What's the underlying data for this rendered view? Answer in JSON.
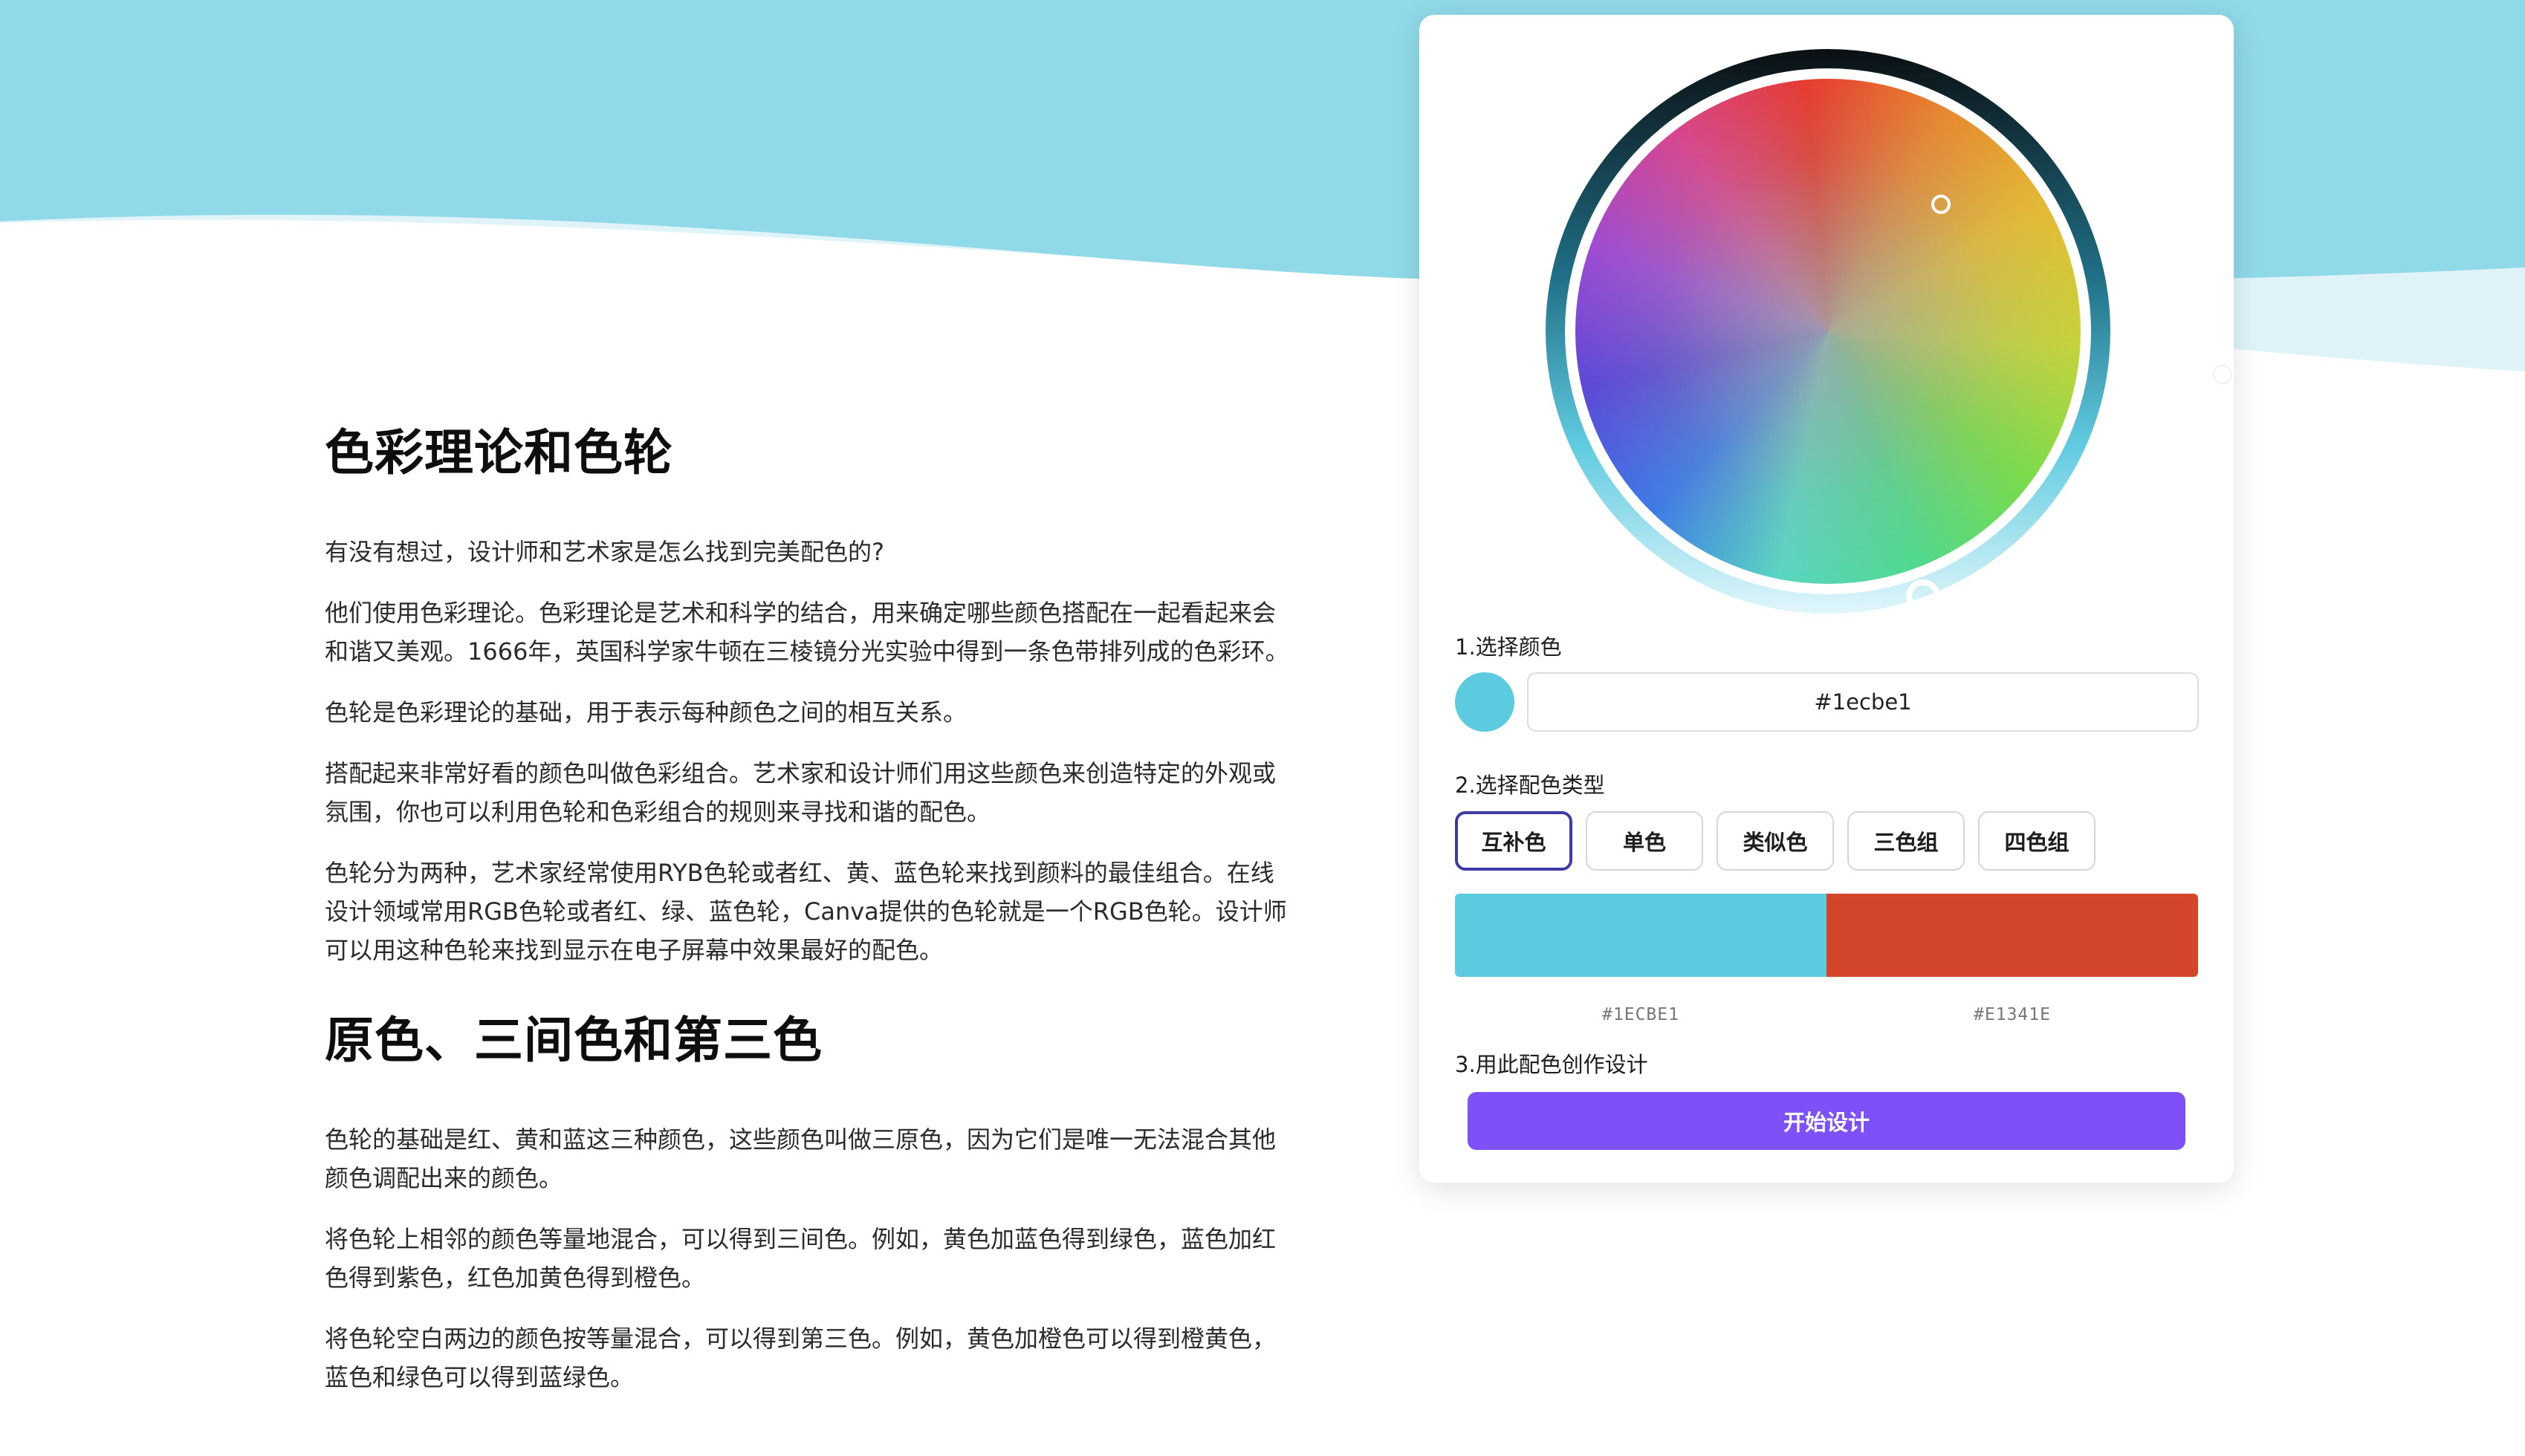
{
  "colors": {
    "accent": "#7d51f7",
    "active_border": "#3e3aa6",
    "header_wave": "#8fd9e8",
    "header_wave_light": "#dff3f8"
  },
  "article": {
    "heading_1": "色彩理论和色轮",
    "paragraphs_1": [
      "有没有想过，设计师和艺术家是怎么找到完美配色的?",
      "他们使用色彩理论。色彩理论是艺术和科学的结合，用来确定哪些颜色搭配在一起看起来会和谐又美观。1666年，英国科学家牛顿在三棱镜分光实验中得到一条色带排列成的色彩环。",
      "色轮是色彩理论的基础，用于表示每种颜色之间的相互关系。",
      "搭配起来非常好看的颜色叫做色彩组合。艺术家和设计师们用这些颜色来创造特定的外观或氛围，你也可以利用色轮和色彩组合的规则来寻找和谐的配色。",
      "色轮分为两种，艺术家经常使用RYB色轮或者红、黄、蓝色轮来找到颜料的最佳组合。在线设计领域常用RGB色轮或者红、绿、蓝色轮，Canva提供的色轮就是一个RGB色轮。设计师可以用这种色轮来找到显示在电子屏幕中效果最好的配色。"
    ],
    "heading_2": "原色、三间色和第三色",
    "paragraphs_2": [
      "色轮的基础是红、黄和蓝这三种颜色，这些颜色叫做三原色，因为它们是唯一无法混合其他颜色调配出来的颜色。",
      "将色轮上相邻的颜色等量地混合，可以得到三间色。例如，黄色加蓝色得到绿色，蓝色加红色得到紫色，红色加黄色得到橙色。",
      "将色轮空白两边的颜色按等量混合，可以得到第三色。例如，黄色加橙色可以得到橙黄色，蓝色和绿色可以得到蓝绿色。"
    ]
  },
  "tool": {
    "step1_label": "1.选择颜色",
    "selected_color": "#5ccadf",
    "hex_value": "#1ecbe1",
    "step2_label": "2.选择配色类型",
    "types": [
      "互补色",
      "单色",
      "类似色",
      "三色组",
      "四色组"
    ],
    "active_type": 0,
    "palette": [
      {
        "hex": "#1ECBE1",
        "color": "#5ccadf"
      },
      {
        "hex": "#E1341E",
        "color": "#d4462b"
      }
    ],
    "step3_label": "3.用此配色创作设计",
    "cta_label": "开始设计"
  }
}
